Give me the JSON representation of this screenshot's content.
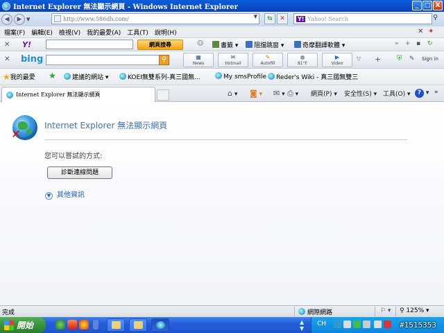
{
  "window": {
    "title": "Internet Explorer 無法顯示網頁 - Windows Internet Explorer",
    "min_label": "_",
    "max_label": "□",
    "close_label": "X"
  },
  "address": {
    "url": "http://www.586dh.com/",
    "search_placeholder": "Yahoo! Search",
    "search_brand": "Y!"
  },
  "menu": {
    "items": [
      "檔案(F)",
      "編輯(E)",
      "檢視(V)",
      "我的最愛(A)",
      "工具(T)",
      "說明(H)"
    ]
  },
  "yahoo_toolbar": {
    "search_button": "網頁搜尋",
    "bookmarks": "書籤",
    "popup_blocker": "阻擋跳窗",
    "translate": "奇摩翻譯軟體"
  },
  "bing_toolbar": {
    "brand": "bing",
    "tiles": [
      "News",
      "Hotmail",
      "Autofill",
      "81°F",
      "Video"
    ],
    "signin": "Sign in"
  },
  "favorites": {
    "label": "我的最愛",
    "suggested": "建議的網站",
    "links": [
      "KOEI無雙系列-真三國無...",
      "My smsProfile",
      "Reder's Wiki - 真三國無雙三"
    ]
  },
  "tab": {
    "label": "Internet Explorer 無法顯示網頁"
  },
  "commands": {
    "page": "網頁(P)",
    "safety": "安全性(S)",
    "tools": "工具(O)"
  },
  "error_page": {
    "title": "Internet Explorer 無法顯示網頁",
    "hint": "您可以嘗試的方式:",
    "diagnose_button": "診斷連線問題",
    "more_info": "其他資訊"
  },
  "statusbar": {
    "status": "完成",
    "zone": "網際網路",
    "zoom": "125%"
  },
  "taskbar": {
    "start": "開始",
    "lang": "CH",
    "watermark": "#1515353"
  },
  "colors": {
    "title_bar": "#0840b8",
    "link_blue": "#2060b8",
    "page_title": "#4470a8",
    "taskbar": "#245edc",
    "start_green": "#3a913a"
  }
}
